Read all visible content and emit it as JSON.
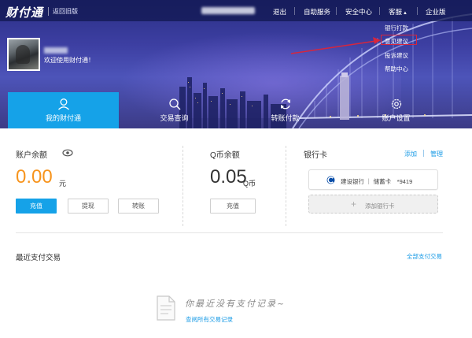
{
  "topbar": {
    "logo": "财付通",
    "return_old": "返回旧版",
    "nav": {
      "logout": "退出",
      "auto_service": "自助服务",
      "security_center": "安全中心",
      "customer_service": "客服",
      "enterprise": "企业版"
    }
  },
  "dropdown": {
    "items": [
      "银行打款",
      "意见建议",
      "投诉建议",
      "帮助中心"
    ],
    "highlighted_index": 1
  },
  "user": {
    "welcome": "欢迎使用财付通！"
  },
  "tabs": [
    {
      "label": "我的财付通",
      "icon": "user-icon",
      "active": true
    },
    {
      "label": "交易查询",
      "icon": "search-icon",
      "active": false
    },
    {
      "label": "转账付款",
      "icon": "transfer-icon",
      "active": false
    },
    {
      "label": "账户设置",
      "icon": "gear-icon",
      "active": false
    }
  ],
  "balance": {
    "title": "账户余额",
    "amount": "0.00",
    "unit": "元",
    "recharge_label": "充值",
    "withdraw_label": "提现",
    "transfer_label": "转账"
  },
  "qcoin": {
    "title": "Q币余额",
    "amount": "0.05",
    "unit": "Q币",
    "recharge_label": "充值"
  },
  "bank": {
    "title": "银行卡",
    "add_link": "添加",
    "manage_link": "管理",
    "card_text": "建设银行 ｜ 储蓄卡　*9419",
    "add_card_label": "添加银行卡"
  },
  "recent": {
    "title": "最近支付交易",
    "all_link": "全部支付交易",
    "empty_text": "你最近没有支付记录~",
    "view_all_link": "查阅所有交易记录"
  },
  "colors": {
    "accent": "#15a2e8",
    "balance_orange": "#f7941d",
    "highlight_red": "#d7263d",
    "banner_blue": "#3d3fa2"
  }
}
